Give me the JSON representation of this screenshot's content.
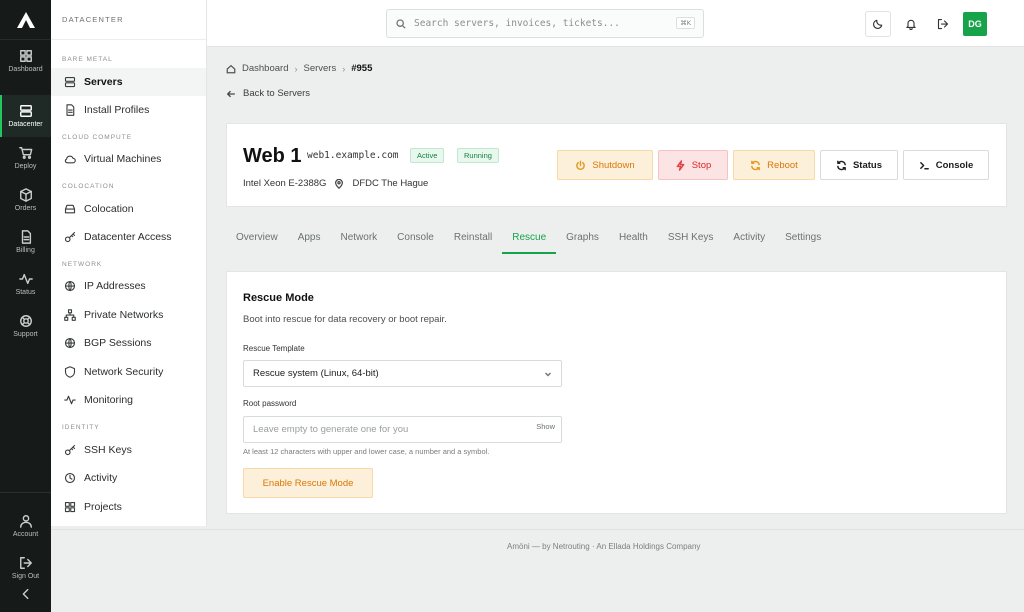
{
  "rail": {
    "items": [
      {
        "label": "Dashboard",
        "icon": "grid-icon"
      },
      {
        "label": "Datacenter",
        "icon": "server-icon"
      },
      {
        "label": "Deploy",
        "icon": "cart-icon"
      },
      {
        "label": "Orders",
        "icon": "box-icon"
      },
      {
        "label": "Billing",
        "icon": "document-icon"
      },
      {
        "label": "Status",
        "icon": "activity-icon"
      },
      {
        "label": "Support",
        "icon": "lifebuoy-icon"
      }
    ],
    "bottom": [
      {
        "label": "Account",
        "icon": "user-icon"
      },
      {
        "label": "Sign Out",
        "icon": "sign-out-icon"
      }
    ],
    "active": "Datacenter"
  },
  "sidebar": {
    "heading": "DATACENTER",
    "sections": [
      {
        "title": "BARE METAL",
        "items": [
          {
            "label": "Servers",
            "icon": "server-icon"
          },
          {
            "label": "Install Profiles",
            "icon": "file-icon"
          }
        ]
      },
      {
        "title": "CLOUD COMPUTE",
        "items": [
          {
            "label": "Virtual Machines",
            "icon": "cloud-icon"
          }
        ]
      },
      {
        "title": "COLOCATION",
        "items": [
          {
            "label": "Colocation",
            "icon": "storage-icon"
          },
          {
            "label": "Datacenter Access",
            "icon": "key-icon"
          }
        ]
      },
      {
        "title": "NETWORK",
        "items": [
          {
            "label": "IP Addresses",
            "icon": "globe-icon"
          },
          {
            "label": "Private Networks",
            "icon": "network-icon"
          },
          {
            "label": "BGP Sessions",
            "icon": "globe-icon"
          },
          {
            "label": "Network Security",
            "icon": "shield-icon"
          },
          {
            "label": "Monitoring",
            "icon": "activity-icon"
          }
        ]
      },
      {
        "title": "IDENTITY",
        "items": [
          {
            "label": "SSH Keys",
            "icon": "key-icon"
          },
          {
            "label": "Activity",
            "icon": "clock-icon"
          },
          {
            "label": "Projects",
            "icon": "grid-icon"
          }
        ]
      }
    ],
    "active": "Servers"
  },
  "topbar": {
    "search_placeholder": "Search servers, invoices, tickets...",
    "shortcut": "⌘K",
    "avatar_initials": "DG",
    "avatar_color": "#16a34a"
  },
  "breadcrumb": {
    "items": [
      "Dashboard",
      "Servers",
      "#955"
    ]
  },
  "back_label": "Back to Servers",
  "server": {
    "name": "Web 1",
    "hostname": "web1.example.com",
    "badges": [
      "Active",
      "Running"
    ],
    "cpu": "Intel Xeon E-2388G",
    "location": "DFDC The Hague"
  },
  "actions": {
    "shutdown": "Shutdown",
    "stop": "Stop",
    "reboot": "Reboot",
    "status": "Status",
    "console": "Console"
  },
  "tabs": [
    "Overview",
    "Apps",
    "Network",
    "Console",
    "Reinstall",
    "Rescue",
    "Graphs",
    "Health",
    "SSH Keys",
    "Activity",
    "Settings"
  ],
  "active_tab": "Rescue",
  "rescue": {
    "title": "Rescue Mode",
    "description": "Boot into rescue for data recovery or boot repair.",
    "template_label": "Rescue Template",
    "template_value": "Rescue system (Linux, 64-bit)",
    "password_label": "Root password",
    "password_placeholder": "Leave empty to generate one for you",
    "show_label": "Show",
    "hint": "At least 12 characters with upper and lower case, a number and a symbol.",
    "submit_label": "Enable Rescue Mode"
  },
  "footer": "Amöni — by Netrouting · An Ellada Holdings Company",
  "colors": {
    "accent": "#16a34a",
    "warning": "#d97706",
    "danger": "#dc2626",
    "rail_bg": "#161b1a"
  }
}
